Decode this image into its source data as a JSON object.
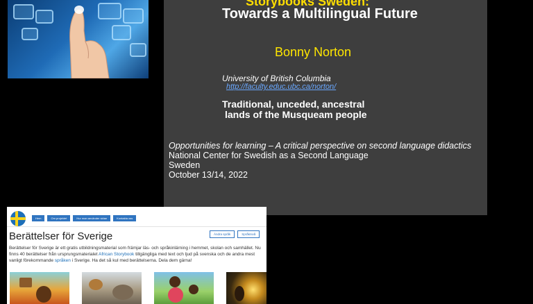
{
  "slide": {
    "title_top": "Storybooks Sweden:",
    "title_main": "Towards a Multilingual Future",
    "author": "Bonny Norton",
    "affiliation": "University of British Columbia",
    "url": "http://faculty.educ.ubc.ca/norton/",
    "land_line1": "Traditional, unceded, ancestral",
    "land_line2": "lands of the Musqueam people",
    "talk_title": "Opportunities for learning – A critical perspective on second language didactics",
    "venue": "National Center for Swedish as a Second Language",
    "country": "Sweden",
    "date": "October 13/14, 2022"
  },
  "website": {
    "nav": [
      "Hem",
      "Om projektet",
      "Hur man använder sidan",
      "Kontakta oss"
    ],
    "title": "Berättelser för Sverige",
    "lang_buttons": [
      "Ändra språk",
      "Språknivå"
    ],
    "desc_part1": "Berättelser för Sverige är ett gratis utbildningsmaterial som främjar läs- och språkinlärning i hemmet, skolan och samhället. Nu finns 40 berättelser från ursprungsmaterialet ",
    "desc_link1": "African Storybook",
    "desc_part2": " tillgängliga med text och ljud på svenska och de andra mest vanligt förekommande ",
    "desc_link2": "språken",
    "desc_part3": " i Sverige. Ha det så kul med berättelserna. Dela dem gärna!"
  },
  "colors": {
    "slide_bg": "#3e3e3e",
    "title_yellow": "#ffde00",
    "author_yellow": "#ffe600",
    "link_blue": "#6aa8ff",
    "nav_blue": "#2f74c0"
  }
}
